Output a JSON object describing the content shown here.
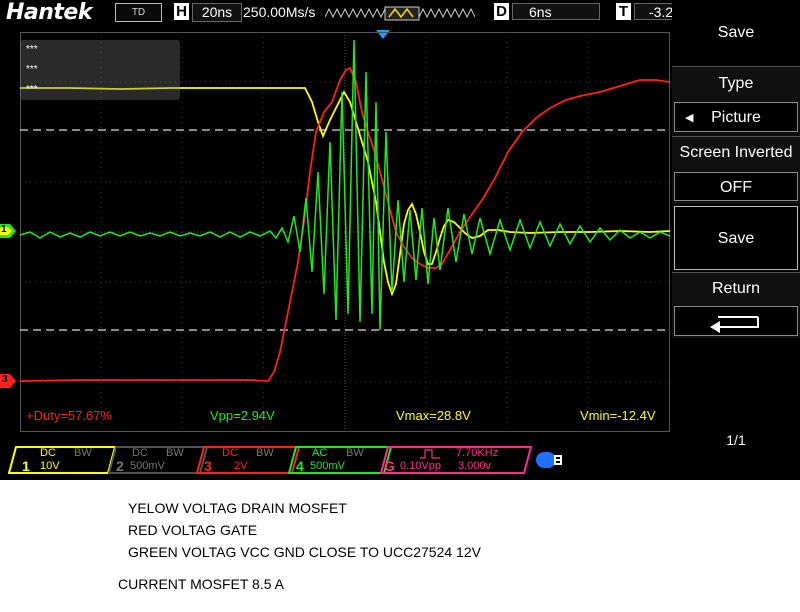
{
  "topbar": {
    "brand": "Hantek",
    "mode": "TD",
    "h_label": "H",
    "h_value": "20ns",
    "sample_rate": "250.00Ms/s",
    "d_label": "D",
    "d_value": "6ns",
    "t_label": "T",
    "t_value": "-3.2"
  },
  "measurements_box": [
    "***",
    "***",
    "***"
  ],
  "readouts": {
    "duty": "+Duty=57.67%",
    "vpp": "Vpp=2.94V",
    "vmax": "Vmax=28.8V",
    "vmin": "Vmin=-12.4V"
  },
  "channel_markers": {
    "ch1": "1",
    "ch3": "3"
  },
  "menu": {
    "title": "Save",
    "type_label": "Type",
    "type_value": "Picture",
    "screen_inverted_label": "Screen Inverted",
    "screen_inverted_value": "OFF",
    "save_button": "Save",
    "return_label": "Return",
    "page": "1/1"
  },
  "channels": [
    {
      "num": "1",
      "coupling": "DC",
      "bw": "BW",
      "scale": "10V",
      "color": "#ffff00",
      "active": true
    },
    {
      "num": "2",
      "coupling": "DC",
      "bw": "BW",
      "scale": "500mV",
      "color": "#7a7a7a",
      "active": false
    },
    {
      "num": "3",
      "coupling": "DC",
      "bw": "BW",
      "scale": "2V",
      "color": "#ff2020",
      "active": true
    },
    {
      "num": "4",
      "coupling": "AC",
      "bw": "BW",
      "scale": "500mV",
      "color": "#22e822",
      "active": true
    }
  ],
  "generator": {
    "label": "G",
    "freq": "7.70KHz",
    "amp": "0.10Vpp",
    "offset": "3.000v",
    "color": "#ff2d8a"
  },
  "colors": {
    "yellow": "#ffff00",
    "red": "#ff2020",
    "green": "#22e822",
    "marker_blue": "#1ea0ff"
  },
  "notes": {
    "line1": "YELOW VOLTAG DRAIN MOSFET",
    "line2": "RED VOLTAG GATE",
    "line3": "GREEN VOLTAG VCC GND CLOSE TO UCC27524 12V",
    "line4": "CURRENT MOSFET 8.5 A"
  }
}
